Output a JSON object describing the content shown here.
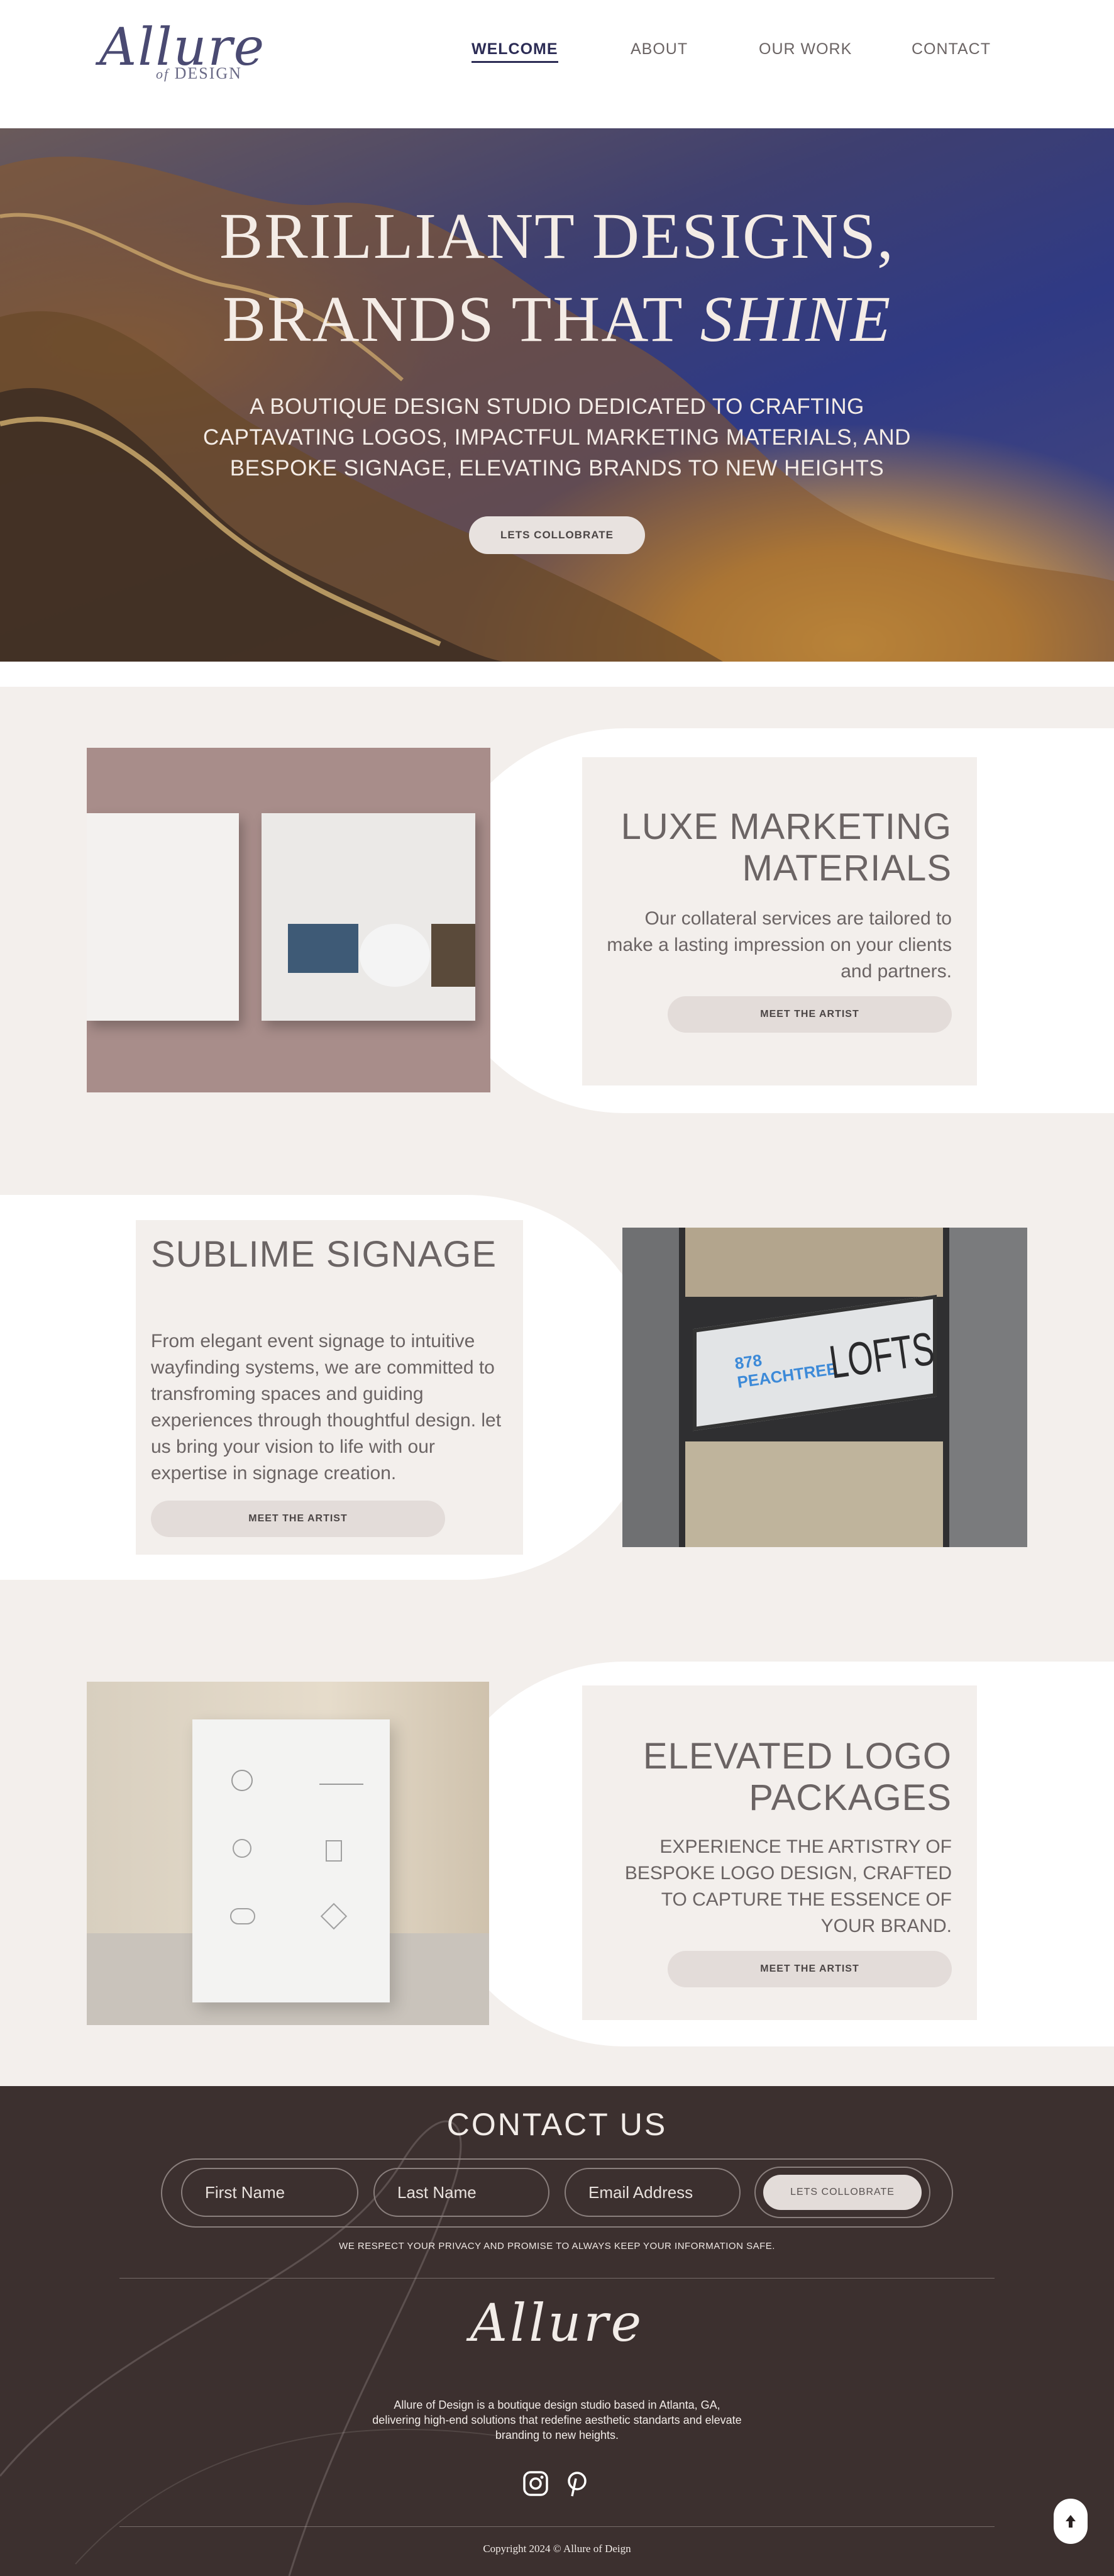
{
  "brand": {
    "logo_script": "Allure",
    "logo_of": "of",
    "logo_design": "DESIGN"
  },
  "nav": {
    "items": [
      {
        "label": "WELCOME",
        "active": true
      },
      {
        "label": "ABOUT",
        "active": false
      },
      {
        "label": "OUR WORK",
        "active": false
      },
      {
        "label": "CONTACT",
        "active": false
      }
    ]
  },
  "hero": {
    "title_line1": "BRILLIANT DESIGNS,",
    "title_line2_prefix": "BRANDS THAT",
    "title_line2_emphasis": "SHINE",
    "subtitle": "A BOUTIQUE DESIGN STUDIO DEDICATED TO CRAFTING CAPTAVATING LOGOS, IMPACTFUL MARKETING MATERIALS, AND BESPOKE SIGNAGE, ELEVATING BRANDS TO NEW HEIGHTS",
    "cta_label": "LETS COLLOBRATE"
  },
  "services": [
    {
      "title": "LUXE MARKETING MATERIALS",
      "body": "Our collateral services are tailored to make a lasting impression on your clients and partners.",
      "button_label": "MEET THE ARTIST",
      "image_icon": "brochure-mockup-image"
    },
    {
      "title": "SUBLIME SIGNAGE",
      "body": "From elegant event signage to intuitive wayfinding systems, we are committed to transfroming spaces and guiding experiences through thoughtful design. let us bring your vision to life with our expertise in signage creation.",
      "button_label": "MEET THE ARTIST",
      "image_icon": "storefront-sign-image",
      "sign_small": "878",
      "sign_small2": "PEACHTREE",
      "sign_big": "LOFTS"
    },
    {
      "title": "ELEVATED LOGO PACKAGES",
      "body": "EXPERIENCE THE ARTISTRY OF BESPOKE LOGO DESIGN, CRAFTED TO CAPTURE THE ESSENCE OF YOUR BRAND.",
      "button_label": "MEET THE ARTIST",
      "image_icon": "logo-card-mockup-image"
    }
  ],
  "contact": {
    "title": "CONTACT US",
    "first_name_placeholder": "First Name",
    "last_name_placeholder": "Last Name",
    "email_placeholder": "Email Address",
    "submit_label": "LETS COLLOBRATE",
    "privacy_note": "WE RESPECT YOUR PRIVACY AND PROMISE TO ALWAYS KEEP YOUR INFORMATION SAFE."
  },
  "footer": {
    "logo_script": "Allure",
    "about": "Allure of Design is a boutique design studio based in Atlanta, GA, delivering high-end solutions that redefine aesthetic standarts and elevate branding to new heights.",
    "social": [
      "instagram-icon",
      "pinterest-icon"
    ],
    "copyright": "Copyright 2024 © Allure of Deign",
    "back_to_top_icon": "arrow-up-icon"
  },
  "colors": {
    "accent_nav": "#2c2c55",
    "band": "#f3efec",
    "footer_bg": "#3c302f",
    "button_bg": "#e3dcd9"
  }
}
